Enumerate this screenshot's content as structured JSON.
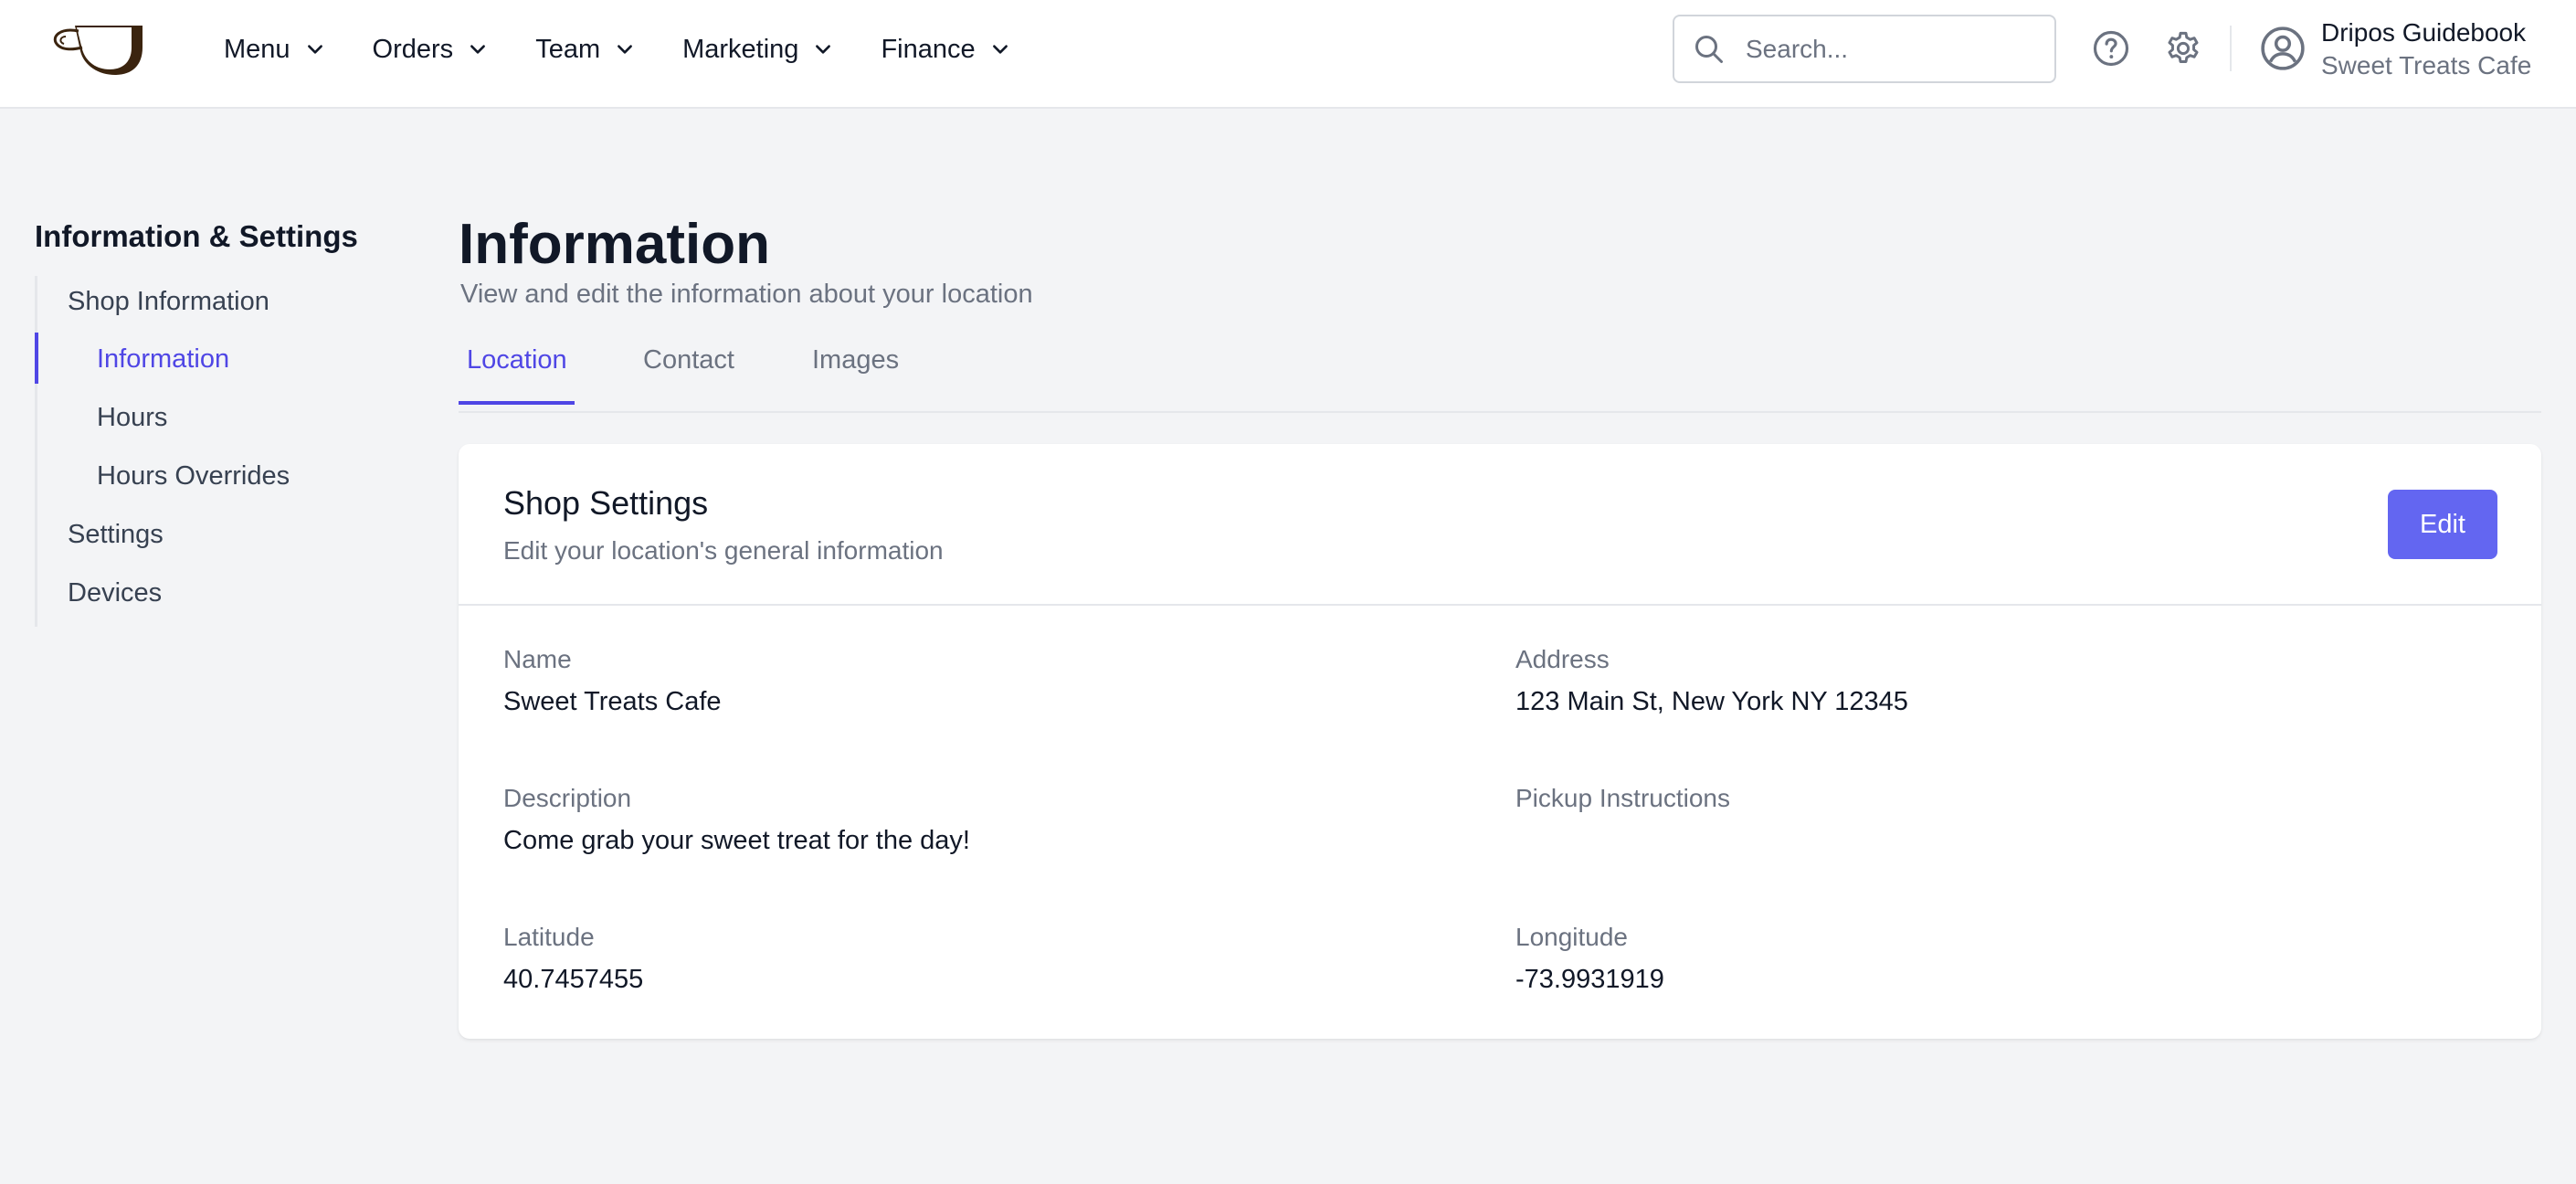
{
  "nav": {
    "items": [
      {
        "label": "Menu"
      },
      {
        "label": "Orders"
      },
      {
        "label": "Team"
      },
      {
        "label": "Marketing"
      },
      {
        "label": "Finance"
      }
    ]
  },
  "search": {
    "placeholder": "Search...",
    "value": ""
  },
  "user": {
    "name": "Dripos Guidebook",
    "shop": "Sweet Treats Cafe"
  },
  "sidebar": {
    "title": "Information & Settings",
    "items": [
      {
        "label": "Shop Information"
      },
      {
        "label": "Information"
      },
      {
        "label": "Hours"
      },
      {
        "label": "Hours Overrides"
      },
      {
        "label": "Settings"
      },
      {
        "label": "Devices"
      }
    ],
    "active": "Information"
  },
  "page": {
    "title": "Information",
    "subtitle": "View and edit the information about your location"
  },
  "tabs": [
    {
      "label": "Location"
    },
    {
      "label": "Contact"
    },
    {
      "label": "Images"
    }
  ],
  "active_tab": "Location",
  "card": {
    "title": "Shop Settings",
    "subtitle": "Edit your location's general information",
    "edit_label": "Edit",
    "fields": {
      "name": {
        "label": "Name",
        "value": "Sweet Treats Cafe"
      },
      "address": {
        "label": "Address",
        "value": "123 Main St, New York NY 12345"
      },
      "description": {
        "label": "Description",
        "value": "Come grab your sweet treat for the day!"
      },
      "pickup": {
        "label": "Pickup Instructions",
        "value": ""
      },
      "latitude": {
        "label": "Latitude",
        "value": "40.7457455"
      },
      "longitude": {
        "label": "Longitude",
        "value": "-73.9931919"
      }
    }
  },
  "colors": {
    "accent": "#4f46e5",
    "button": "#6366f1",
    "background": "#f3f4f6",
    "muted_text": "#6b7280"
  },
  "icons": {
    "logo": "coffee-cup-icon",
    "nav_dropdown": "chevron-down-icon",
    "search": "search-icon",
    "help": "help-circle-icon",
    "settings": "gear-icon",
    "user": "user-circle-icon"
  }
}
